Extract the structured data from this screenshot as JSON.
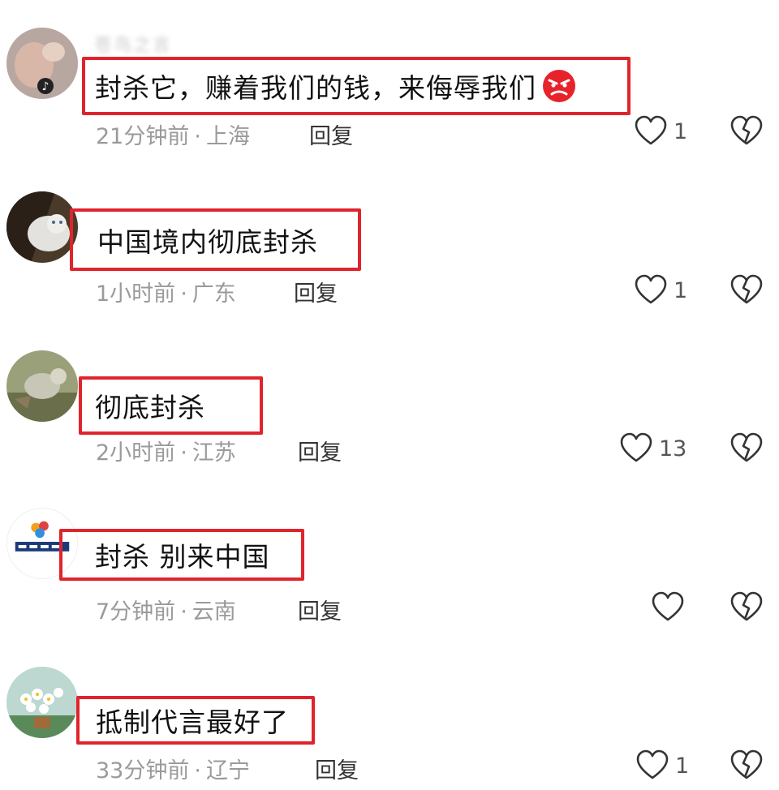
{
  "comments": [
    {
      "username": "苍鸟之言",
      "text": "封杀它，赚着我们的钱，来侮辱我们",
      "time": "21分钟前",
      "location": "上海",
      "reply_label": "回复",
      "likes": "1",
      "emoji": "angry-face"
    },
    {
      "username": "",
      "text": "中国境内彻底封杀",
      "time": "1小时前",
      "location": "广东",
      "reply_label": "回复",
      "likes": "1"
    },
    {
      "username": "",
      "text": "彻底封杀",
      "time": "2小时前",
      "location": "江苏",
      "reply_label": "回复",
      "likes": "13"
    },
    {
      "username": "",
      "text": "封杀 别来中国",
      "time": "7分钟前",
      "location": "云南",
      "reply_label": "回复",
      "likes": ""
    },
    {
      "username": "",
      "text": "抵制代言最好了",
      "time": "33分钟前",
      "location": "辽宁",
      "reply_label": "回复",
      "likes": "1"
    }
  ],
  "meta_separator": "·",
  "colors": {
    "highlight_border": "#e0242c",
    "meta_text": "#9a9a9a"
  }
}
